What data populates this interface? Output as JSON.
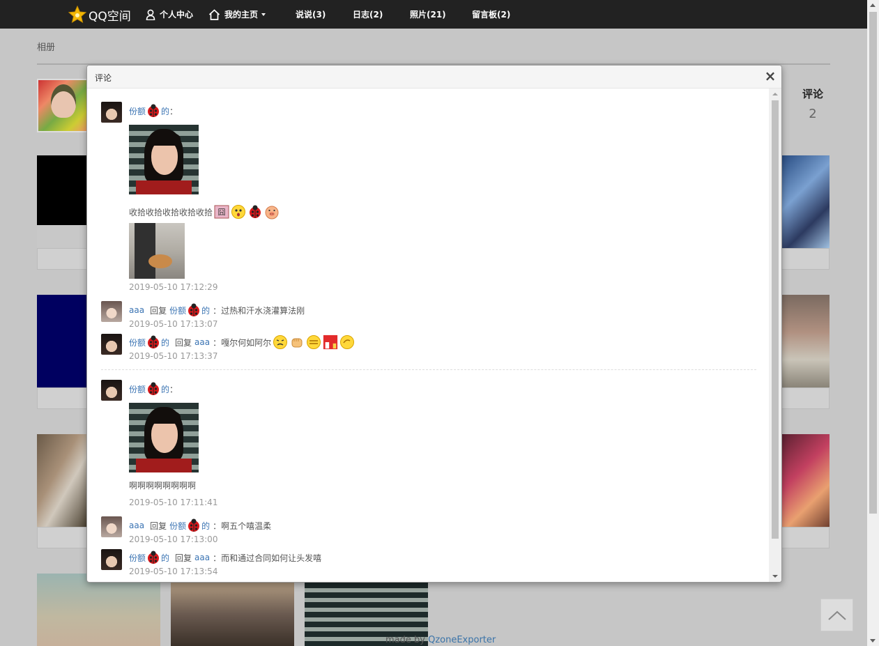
{
  "navbar": {
    "brand": "QQ空间",
    "items": [
      {
        "label": "个人中心",
        "icon": "user-icon"
      },
      {
        "label": "我的主页",
        "icon": "home-icon",
        "dropdown": true
      },
      {
        "label": "说说(3)"
      },
      {
        "label": "日志(2)"
      },
      {
        "label": "照片(21)"
      },
      {
        "label": "留言板(2)"
      }
    ]
  },
  "page": {
    "breadcrumb": "相册",
    "side_stat": {
      "label": "评论",
      "value": "2"
    },
    "credit": {
      "prefix": "made by ",
      "name": "QzoneExporter"
    }
  },
  "modal": {
    "title": "评论",
    "close": "×",
    "threads": [
      {
        "author": "份额",
        "author_suffix": "的",
        "colon": "：",
        "text": "收拾收拾收拾收拾收拾",
        "timestamp": "2019-05-10 17:12:29",
        "emojis": [
          "jiong-icon",
          "shocked-icon",
          "ladybug-icon",
          "pig-icon"
        ],
        "replies": [
          {
            "from": "aaa",
            "reply_word": "回复",
            "to": "份额",
            "to_suffix": "的",
            "text": "：过热和汗水浇灌算法刚",
            "timestamp": "2019-05-10 17:13:07"
          },
          {
            "from": "份额",
            "from_suffix": "的",
            "reply_word": "回复",
            "to": "aaa",
            "text": "：嘎尔何如阿尔",
            "timestamp": "2019-05-10 17:13:37",
            "emojis": [
              "grimace-icon",
              "fist-icon",
              "bored-icon",
              "red-packet-icon",
              "wave-icon"
            ]
          }
        ]
      },
      {
        "author": "份额",
        "author_suffix": "的",
        "colon": "：",
        "text": "啊啊啊啊啊啊啊啊",
        "timestamp": "2019-05-10 17:11:41",
        "replies": [
          {
            "from": "aaa",
            "reply_word": "回复",
            "to": "份额",
            "to_suffix": "的",
            "text": "：啊五个嘻温柔",
            "timestamp": "2019-05-10 17:13:00"
          },
          {
            "from": "份额",
            "from_suffix": "的",
            "reply_word": "回复",
            "to": "aaa",
            "text": "：而和通过合同如何让头发嘻",
            "timestamp": "2019-05-10 17:13:54"
          }
        ]
      }
    ]
  },
  "colors": {
    "navbar": "#222222",
    "link": "#3b74b3",
    "overlay": "#c6c6c6"
  }
}
